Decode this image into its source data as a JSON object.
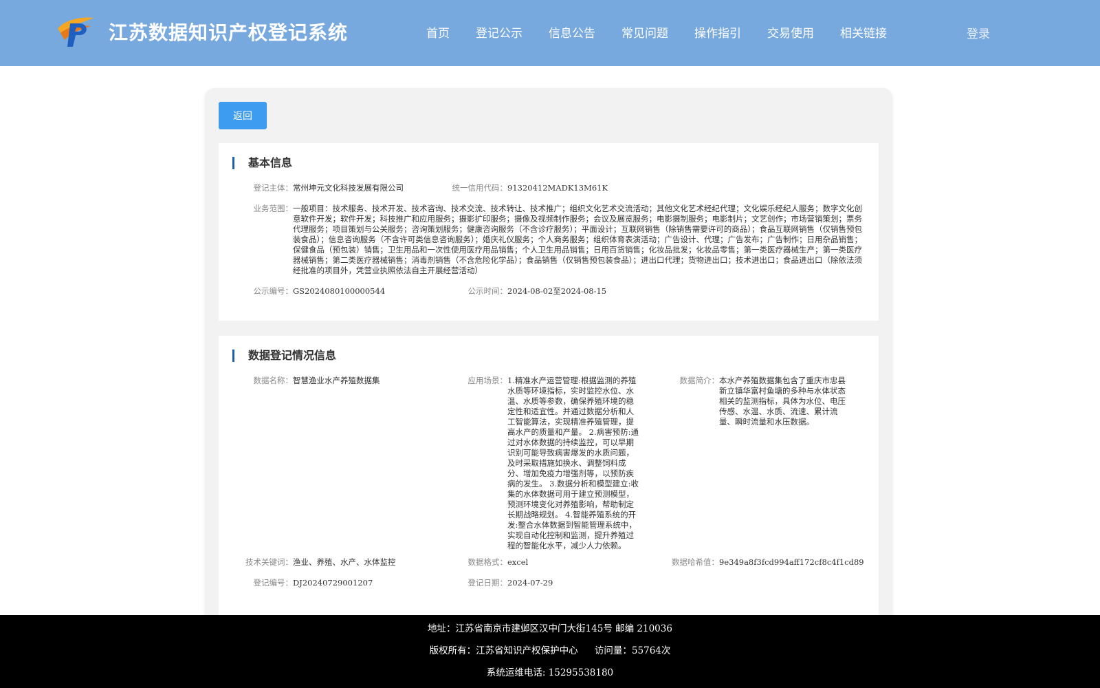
{
  "header": {
    "title": "江苏数据知识产权登记系统",
    "nav": [
      "首页",
      "登记公示",
      "信息公告",
      "常见问题",
      "操作指引",
      "交易使用",
      "相关链接"
    ],
    "login": "登录",
    "bg_color": "#78a9de"
  },
  "back_button": "返回",
  "basic_info": {
    "title": "基本信息",
    "subject_label": "登记主体：",
    "subject": "常州坤元文化科技发展有限公司",
    "credit_code_label": "统一信用代码：",
    "credit_code": "91320412MADK13M61K",
    "business_scope_label": "业务范围：",
    "business_scope": "一般项目：技术服务、技术开发、技术咨询、技术交流、技术转让、技术推广；组织文化艺术交流活动；其他文化艺术经纪代理；文化娱乐经纪人服务；数字文化创意软件开发；软件开发；科技推广和应用服务；摄影扩印服务；摄像及视频制作服务；会议及展览服务；电影摄制服务；电影制片；文艺创作；市场营销策划；票务代理服务；项目策划与公关服务；咨询策划服务；健康咨询服务（不含诊疗服务）；平面设计；互联网销售（除销售需要许可的商品）；食品互联网销售（仅销售预包装食品）；信息咨询服务（不含许可类信息咨询服务）；婚庆礼仪服务；个人商务服务；组织体育表演活动；广告设计、代理；广告发布；广告制作；日用杂品销售；保健食品（预包装）销售；卫生用品和一次性使用医疗用品销售；个人卫生用品销售；日用百货销售；化妆品批发；化妆品零售；第一类医疗器械生产；第一类医疗器械销售；第二类医疗器械销售；消毒剂销售（不含危险化学品）；食品销售（仅销售预包装食品）；进出口代理；货物进出口；技术进出口；食品进出口（除依法须经批准的项目外，凭营业执照依法自主开展经营活动）",
    "notice_no_label": "公示编号：",
    "notice_no": "GS2024080100000544",
    "notice_time_label": "公示时间：",
    "notice_time": "2024-08-02至2024-08-15"
  },
  "registration_info": {
    "title": "数据登记情况信息",
    "data_name_label": "数据名称：",
    "data_name": "智慧渔业水产养殖数据集",
    "scenario_label": "应用场景：",
    "scenario": "1.精准水产运营管理:根据监测的养殖水质等环境指标，实时监控水位、水温、水质等参数，确保养殖环境的稳定性和适宜性。并通过数据分析和人工智能算法，实现精准养殖管理，提高水产的质量和产量。 2.病害预防:通过对水体数据的持续监控，可以早期识别可能导致病害爆发的水质问题，及时采取措施如换水、调整饲料成分、增加免疫力增强剂等，以预防疾病的发生。 3.数据分析和模型建立:收集的水体数据可用于建立预测模型，预测环境变化对养殖影响，帮助制定长期战略规划。 4.智能养殖系统的开发:整合水体数据到智能管理系统中，实现自动化控制和监测，提升养殖过程的智能化水平，减少人力依赖。",
    "intro_label": "数据简介：",
    "intro": "本水产养殖数据集包含了重庆市忠县新立镇华富村鱼塘的多种与水体状态相关的监测指标，具体为水位、电压传感、水温、水质、流速、累计流量、瞬时流量和水压数据。",
    "keywords_label": "技术关键词：",
    "keywords": "渔业、养殖、水产、水体监控",
    "format_label": "数据格式：",
    "format": "excel",
    "hash_label": "数据哈希值：",
    "hash": "9e349a8f3fcd994aff172cf8c4f1cd89",
    "reg_no_label": "登记编号：",
    "reg_no": "DJ20240729001207",
    "reg_date_label": "登记日期：",
    "reg_date": "2024-07-29"
  },
  "footer": {
    "address": "地址：江苏省南京市建邺区汉中门大街145号 邮编 210036",
    "copyright": "版权所有：江苏省知识产权保护中心",
    "visits": "访问量：55764次",
    "phone": "系统运维电话: 15295538180"
  }
}
